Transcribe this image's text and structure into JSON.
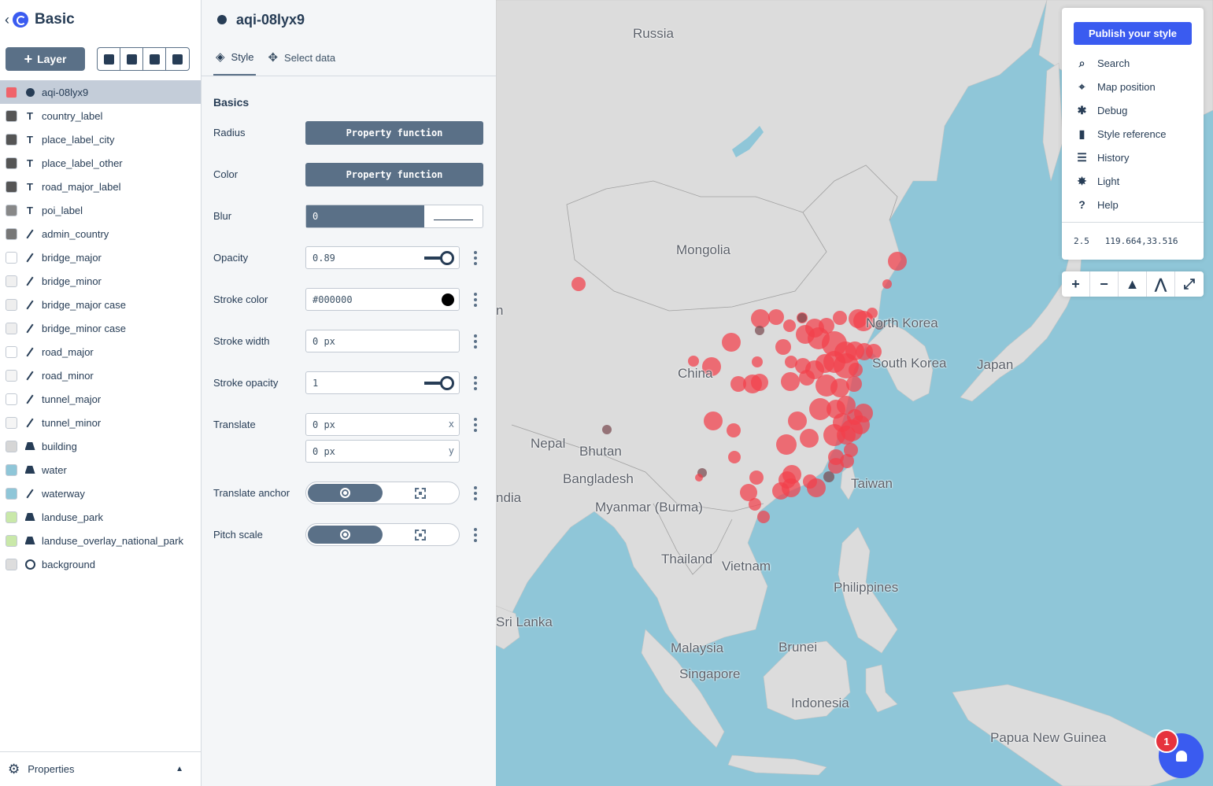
{
  "sidebar": {
    "title": "Basic",
    "add_layer_label": "Layer",
    "footer_label": "Properties",
    "layers": [
      {
        "name": "aqi-08lyx9",
        "type": "circle",
        "color": "#f0636a",
        "active": true
      },
      {
        "name": "country_label",
        "type": "symbol",
        "color": "#555555"
      },
      {
        "name": "place_label_city",
        "type": "symbol",
        "color": "#555555"
      },
      {
        "name": "place_label_other",
        "type": "symbol",
        "color": "#555555"
      },
      {
        "name": "road_major_label",
        "type": "symbol",
        "color": "#555555"
      },
      {
        "name": "poi_label",
        "type": "symbol",
        "color": "#888888"
      },
      {
        "name": "admin_country",
        "type": "line",
        "color": "#777777"
      },
      {
        "name": "bridge_major",
        "type": "line",
        "color": "#ffffff"
      },
      {
        "name": "bridge_minor",
        "type": "line",
        "color": "#f0f0f0"
      },
      {
        "name": "bridge_major case",
        "type": "line",
        "color": "#eeeeee"
      },
      {
        "name": "bridge_minor case",
        "type": "line",
        "color": "#eeeeee"
      },
      {
        "name": "road_major",
        "type": "line",
        "color": "#ffffff"
      },
      {
        "name": "road_minor",
        "type": "line",
        "color": "#f5f5f5"
      },
      {
        "name": "tunnel_major",
        "type": "line",
        "color": "#ffffff"
      },
      {
        "name": "tunnel_minor",
        "type": "line",
        "color": "#f5f5f5"
      },
      {
        "name": "building",
        "type": "fill",
        "color": "#d6d6d6"
      },
      {
        "name": "water",
        "type": "fill",
        "color": "#8fc6d8"
      },
      {
        "name": "waterway",
        "type": "line",
        "color": "#8fc6d8"
      },
      {
        "name": "landuse_park",
        "type": "fill",
        "color": "#c9e8a9"
      },
      {
        "name": "landuse_overlay_national_park",
        "type": "fill",
        "color": "#c9e8a9"
      },
      {
        "name": "background",
        "type": "background",
        "color": "#dddddd"
      }
    ]
  },
  "panel": {
    "layer_name": "aqi-08lyx9",
    "tab_style": "Style",
    "tab_select": "Select data",
    "section": "Basics",
    "radius_label": "Radius",
    "radius_value": "Property function",
    "color_label": "Color",
    "color_value": "Property function",
    "blur_label": "Blur",
    "blur_value": "0",
    "opacity_label": "Opacity",
    "opacity_value": "0.89",
    "stroke_color_label": "Stroke color",
    "stroke_color_value": "#000000",
    "stroke_width_label": "Stroke width",
    "stroke_width_value": "0 px",
    "stroke_opacity_label": "Stroke opacity",
    "stroke_opacity_value": "1",
    "translate_label": "Translate",
    "translate_x": "0 px",
    "translate_y": "0 px",
    "axis_x": "x",
    "axis_y": "y",
    "translate_anchor_label": "Translate anchor",
    "pitch_scale_label": "Pitch scale"
  },
  "menu": {
    "publish": "Publish your style",
    "items": [
      "Search",
      "Map position",
      "Debug",
      "Style reference",
      "History",
      "Light",
      "Help"
    ],
    "zoom": "2.5",
    "coords": "119.664,33.516"
  },
  "map_labels": {
    "russia": "Russia",
    "mongolia": "Mongolia",
    "north_korea": "North Korea",
    "south_korea": "South Korea",
    "japan": "Japan",
    "china": "China",
    "nepal": "Nepal",
    "bhutan": "Bhutan",
    "bangladesh": "Bangladesh",
    "india": "ndia",
    "pakistan_partial": "n",
    "myanmar": "Myanmar (Burma)",
    "taiwan": "Taiwan",
    "thailand": "Thailand",
    "vietnam": "Vietnam",
    "philippines": "Philippines",
    "sri_lanka": "Sri Lanka",
    "malaysia": "Malaysia",
    "brunei": "Brunei",
    "singapore": "Singapore",
    "indonesia": "Indonesia",
    "png": "Papua New Guinea"
  },
  "notifications": {
    "count": "1"
  },
  "colors": {
    "accent": "#3a5bf0",
    "point": "#f2404b",
    "point_dark": "#7a4b50",
    "water": "#8fc6d8",
    "land": "#dcdcdc"
  }
}
